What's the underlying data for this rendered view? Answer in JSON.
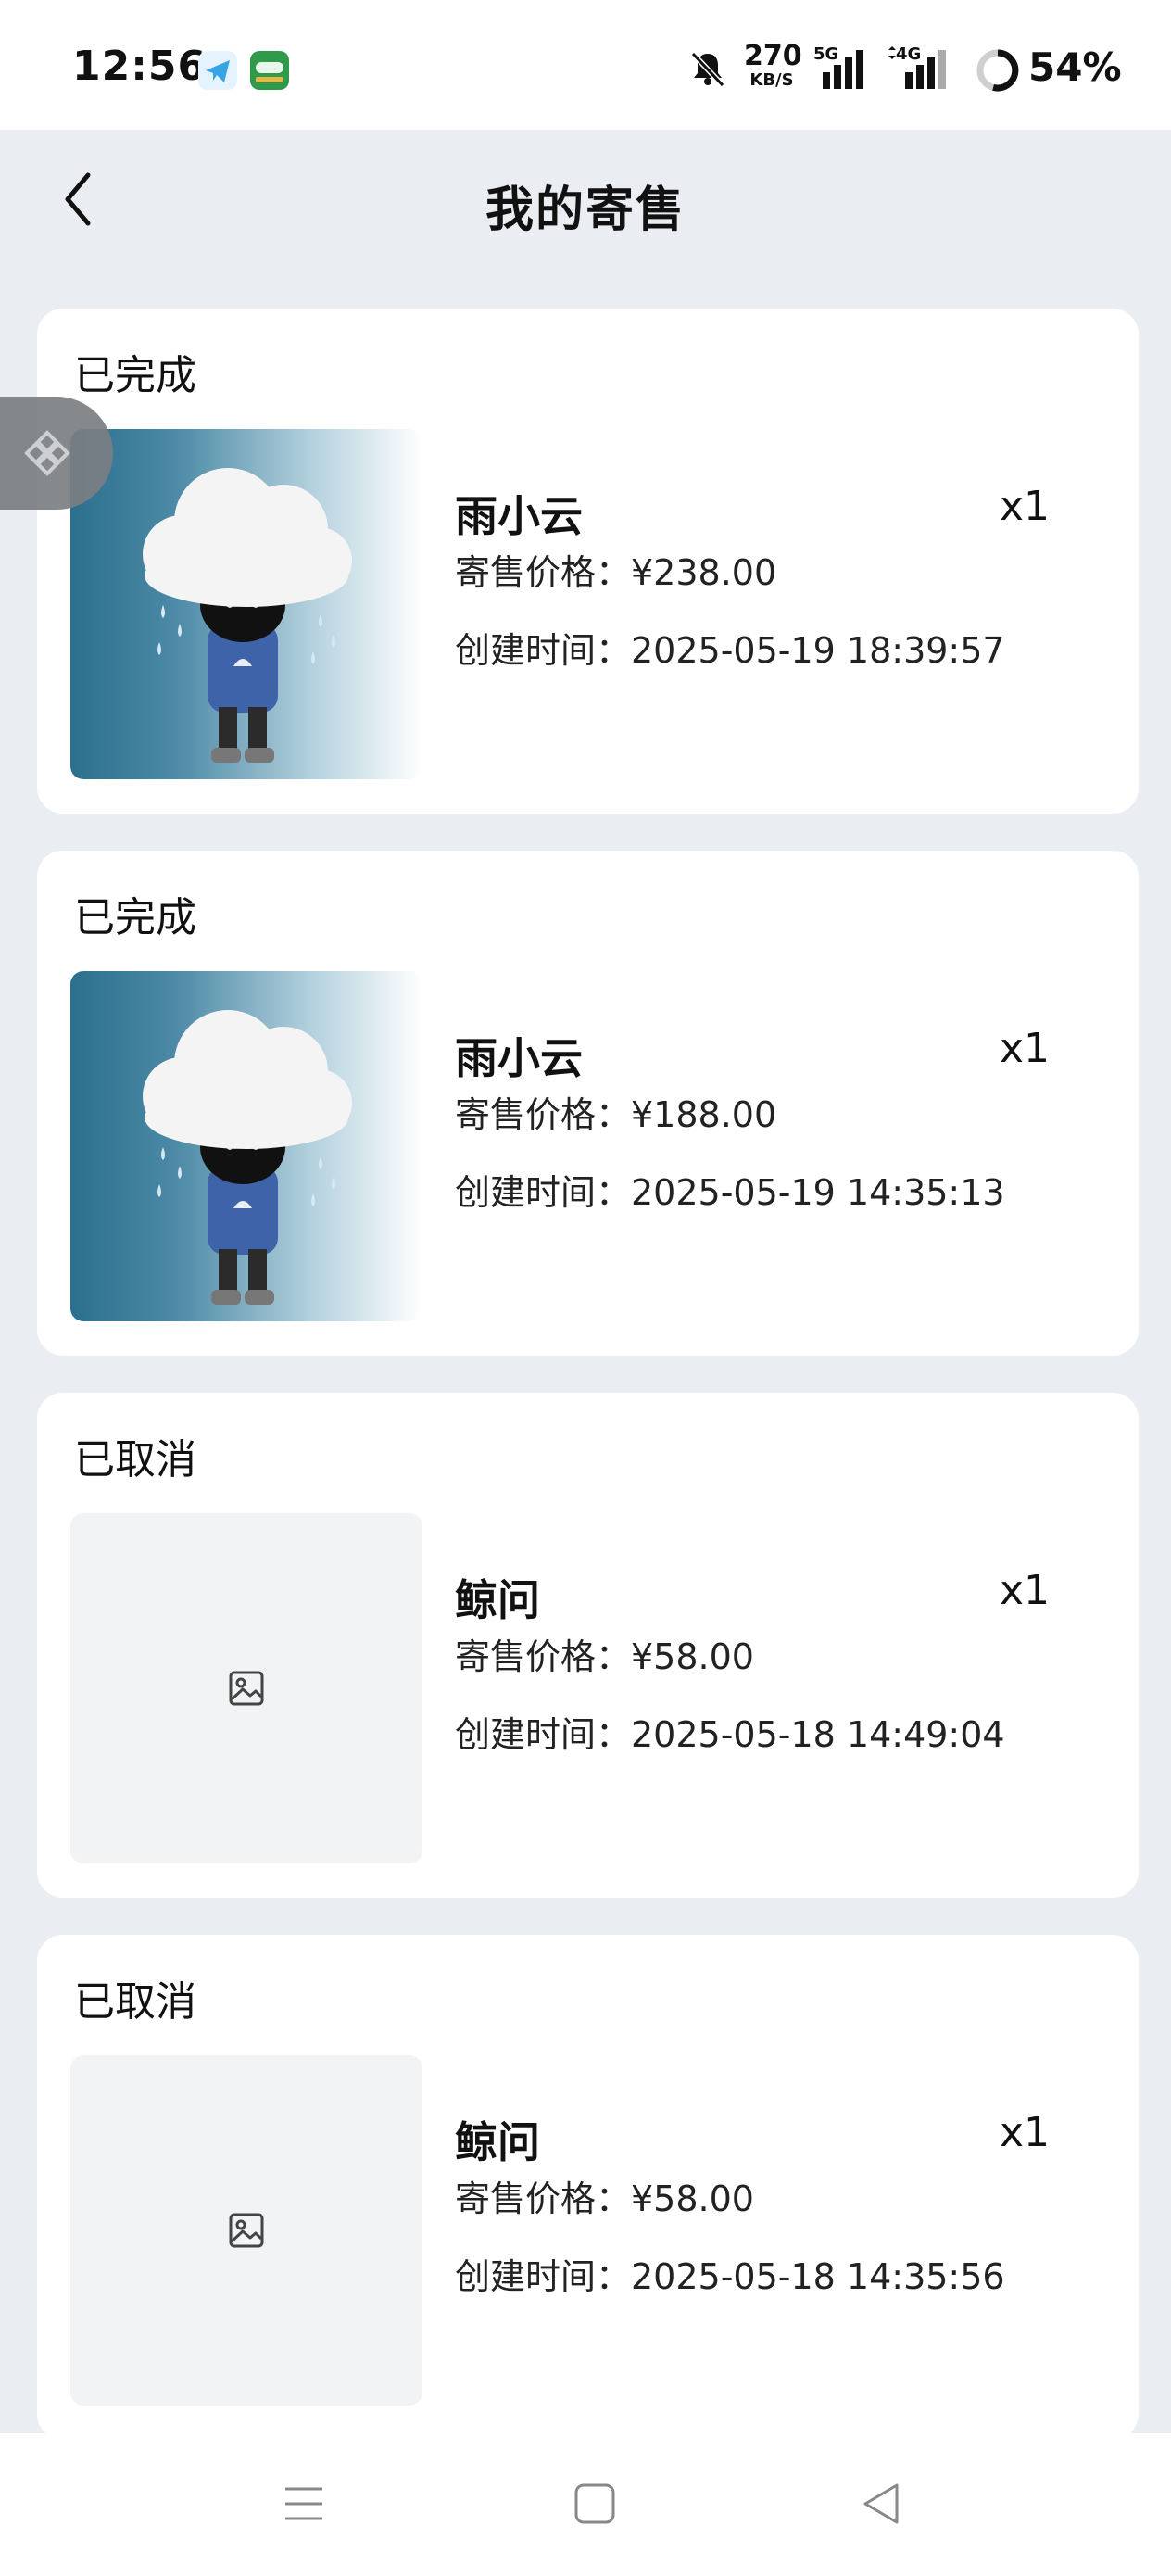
{
  "status_bar": {
    "time": "12:56",
    "net_speed_value": "270",
    "net_speed_unit": "KB/S",
    "signal_1_label": "5G",
    "signal_2_label": "4G",
    "battery_text": "54%"
  },
  "header": {
    "title": "我的寄售"
  },
  "orders": [
    {
      "status": "已完成",
      "name": "雨小云",
      "quantity": "x1",
      "price_text": "寄售价格：¥238.00",
      "created_text": "创建时间：2025-05-19 18:39:57",
      "image": "photo"
    },
    {
      "status": "已完成",
      "name": "雨小云",
      "quantity": "x1",
      "price_text": "寄售价格：¥188.00",
      "created_text": "创建时间：2025-05-19 14:35:13",
      "image": "photo"
    },
    {
      "status": "已取消",
      "name": "鲸问",
      "quantity": "x1",
      "price_text": "寄售价格：¥58.00",
      "created_text": "创建时间：2025-05-18 14:49:04",
      "image": "placeholder"
    },
    {
      "status": "已取消",
      "name": "鲸问",
      "quantity": "x1",
      "price_text": "寄售价格：¥58.00",
      "created_text": "创建时间：2025-05-18 14:35:56",
      "image": "placeholder"
    }
  ],
  "icons": {
    "back": "chevron-left-icon",
    "placeholder": "image-placeholder-icon",
    "float": "diamond-logo-icon",
    "nav_menu": "menu-icon",
    "nav_home": "home-square-icon",
    "nav_back": "back-triangle-icon"
  },
  "colors": {
    "page_background": "#eaeef2",
    "card_background": "#ffffff",
    "placeholder_background": "#f2f3f5"
  }
}
